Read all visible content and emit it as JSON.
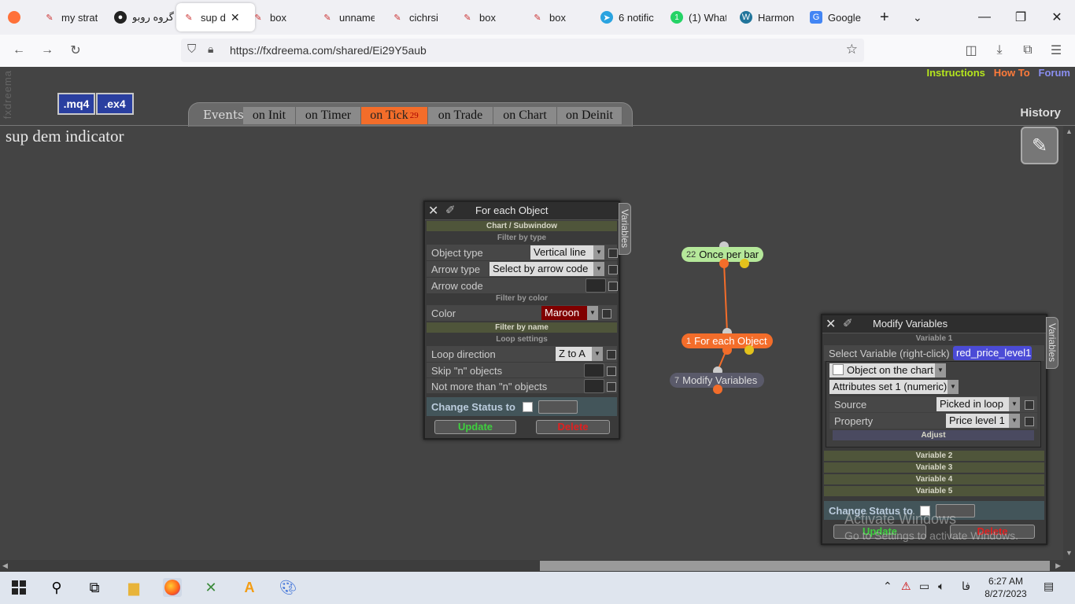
{
  "browser": {
    "tabs": [
      {
        "label": "my strat",
        "icon": "fxdreema-icon"
      },
      {
        "label": "گروه روبو",
        "icon": "github-icon"
      },
      {
        "label": "sup d",
        "icon": "fxdreema-icon",
        "active": true
      },
      {
        "label": "box",
        "icon": "fxdreema-icon"
      },
      {
        "label": "unname",
        "icon": "fxdreema-icon"
      },
      {
        "label": "cichrsi",
        "icon": "fxdreema-icon"
      },
      {
        "label": "box",
        "icon": "fxdreema-icon"
      },
      {
        "label": "box",
        "icon": "fxdreema-icon"
      },
      {
        "label": "6 notific",
        "icon": "telegram-icon"
      },
      {
        "label": "(1) What",
        "icon": "whatsapp-icon"
      },
      {
        "label": "Harmon",
        "icon": "wordpress-icon"
      },
      {
        "label": "Google",
        "icon": "google-translate-icon"
      }
    ],
    "url": "https://fxdreema.com/shared/Ei29Y5aub"
  },
  "page": {
    "side_mark": "fxdreema",
    "btn_mq4": ".mq4",
    "btn_ex4": ".ex4",
    "links": {
      "instructions": "Instructions",
      "howto": "How To",
      "forum": "Forum"
    },
    "events_label": "Events",
    "event_tabs": [
      "on Init",
      "on Timer",
      "on Tick",
      "on Trade",
      "on Chart",
      "on Deinit"
    ],
    "tick_badge": "29",
    "history": "History",
    "project_title": "sup dem indicator"
  },
  "for_each": {
    "title": "For each Object",
    "vars_tab": "Variables",
    "section_chart": "Chart / Subwindow",
    "filter_type": "Filter by type",
    "object_type_label": "Object type",
    "object_type_value": "Vertical line",
    "arrow_type_label": "Arrow type",
    "arrow_type_value": "Select by arrow code",
    "arrow_code_label": "Arrow code",
    "filter_color": "Filter by color",
    "color_label": "Color",
    "color_value": "Maroon",
    "filter_name": "Filter by name",
    "loop_settings": "Loop settings",
    "loop_dir_label": "Loop direction",
    "loop_dir_value": "Z to A",
    "skip_label": "Skip \"n\" objects",
    "notmore_label": "Not more than \"n\" objects",
    "change_status": "Change Status to",
    "update": "Update",
    "delete": "Delete"
  },
  "modify": {
    "title": "Modify Variables",
    "vars_tab": "Variables",
    "variable1": "Variable 1",
    "select_var_label": "Select Variable (right-click)",
    "select_var_value": "red_price_level1",
    "object_sel": "Object on the chart",
    "attrs_sel": "Attributes set 1 (numeric)",
    "source_label": "Source",
    "source_value": "Picked in loop",
    "property_label": "Property",
    "property_value": "Price level 1",
    "adjust": "Adjust",
    "variable2": "Variable 2",
    "variable3": "Variable 3",
    "variable4": "Variable 4",
    "variable5": "Variable 5",
    "change_status": "Change Status to",
    "update": "Update",
    "delete": "Delete"
  },
  "blocks": {
    "b1_num": "22",
    "b1_label": "Once per bar",
    "b2_num": "1",
    "b2_label": "For each Object",
    "b3_num": "7",
    "b3_label": "Modify Variables"
  },
  "watermark": {
    "line1": "Activate Windows",
    "line2": "Go to Settings to activate Windows."
  },
  "taskbar": {
    "lang": "فا",
    "time": "6:27 AM",
    "date": "8/27/2023"
  },
  "colors": {
    "accent_orange": "#f36d2a",
    "link_green": "#b5e61d",
    "link_orange": "#ff7b3a",
    "link_blue": "#8a8ef0",
    "maroon": "#800000"
  }
}
